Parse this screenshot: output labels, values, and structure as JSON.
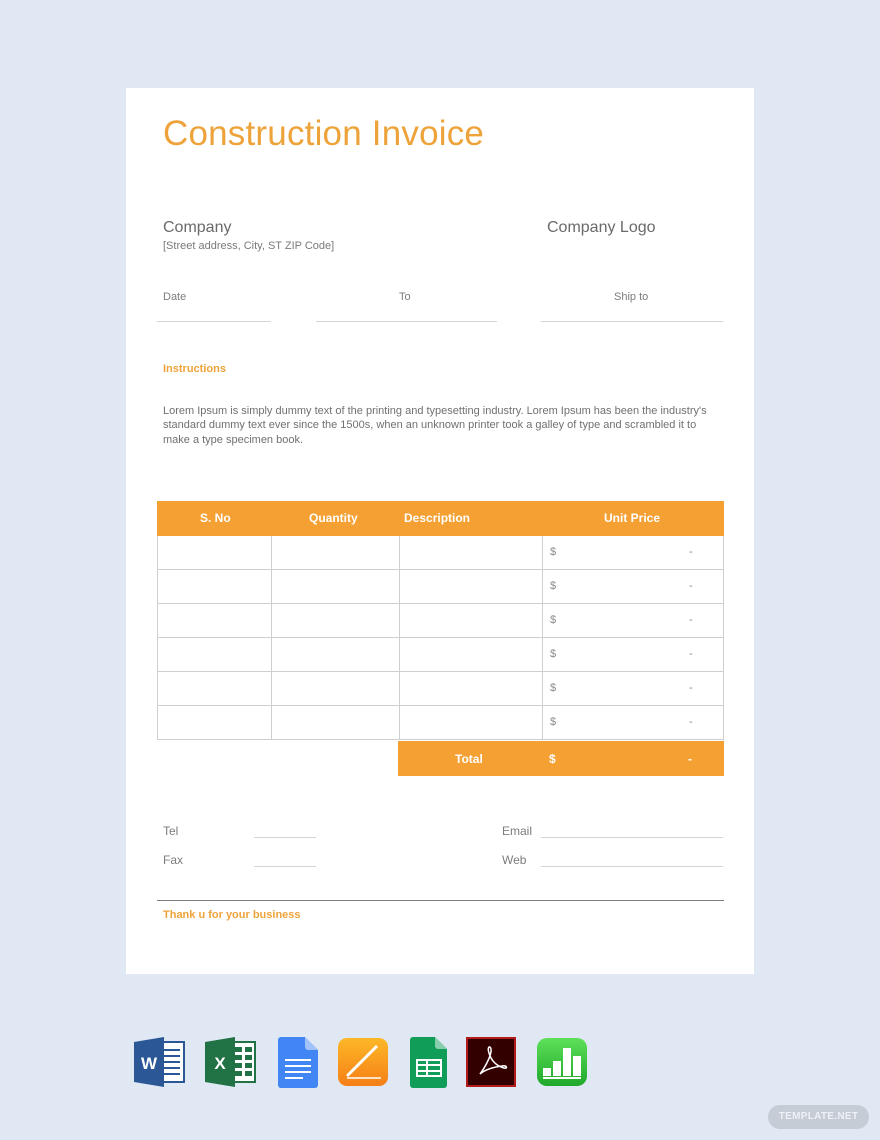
{
  "document": {
    "title": "Construction Invoice",
    "company_name": "Company",
    "company_address": "[Street address, City, ST ZIP Code]",
    "company_logo_label": "Company Logo",
    "fields": {
      "date_label": "Date",
      "to_label": "To",
      "ship_to_label": "Ship to"
    },
    "instructions": {
      "heading": "Instructions",
      "body": "Lorem Ipsum is simply dummy text of the printing and typesetting industry. Lorem Ipsum has been the industry's standard dummy text ever since the 1500s, when an unknown printer took a galley of type and scrambled it to make a type specimen book."
    },
    "table": {
      "headers": [
        "S. No",
        "Quantity",
        "Description",
        "Unit Price"
      ],
      "rows": [
        {
          "sno": "",
          "quantity": "",
          "description": "",
          "currency": "$",
          "unit_price": "-"
        },
        {
          "sno": "",
          "quantity": "",
          "description": "",
          "currency": "$",
          "unit_price": "-"
        },
        {
          "sno": "",
          "quantity": "",
          "description": "",
          "currency": "$",
          "unit_price": "-"
        },
        {
          "sno": "",
          "quantity": "",
          "description": "",
          "currency": "$",
          "unit_price": "-"
        },
        {
          "sno": "",
          "quantity": "",
          "description": "",
          "currency": "$",
          "unit_price": "-"
        },
        {
          "sno": "",
          "quantity": "",
          "description": "",
          "currency": "$",
          "unit_price": "-"
        }
      ],
      "total_label": "Total",
      "total_currency": "$",
      "total_value": "-"
    },
    "contact": {
      "tel_label": "Tel",
      "fax_label": "Fax",
      "email_label": "Email",
      "web_label": "Web"
    },
    "footer_note": "Thank u for your business"
  },
  "colors": {
    "accent": "#f5a033",
    "title": "#eea33a",
    "background": "#dfe8f3"
  },
  "format_icons": [
    {
      "name": "word-icon",
      "label": "W"
    },
    {
      "name": "excel-icon",
      "label": "X"
    },
    {
      "name": "google-docs-icon",
      "label": ""
    },
    {
      "name": "pages-icon",
      "label": ""
    },
    {
      "name": "google-sheets-icon",
      "label": ""
    },
    {
      "name": "acrobat-pdf-icon",
      "label": ""
    },
    {
      "name": "numbers-icon",
      "label": ""
    }
  ],
  "watermark": "TEMPLATE.NET"
}
